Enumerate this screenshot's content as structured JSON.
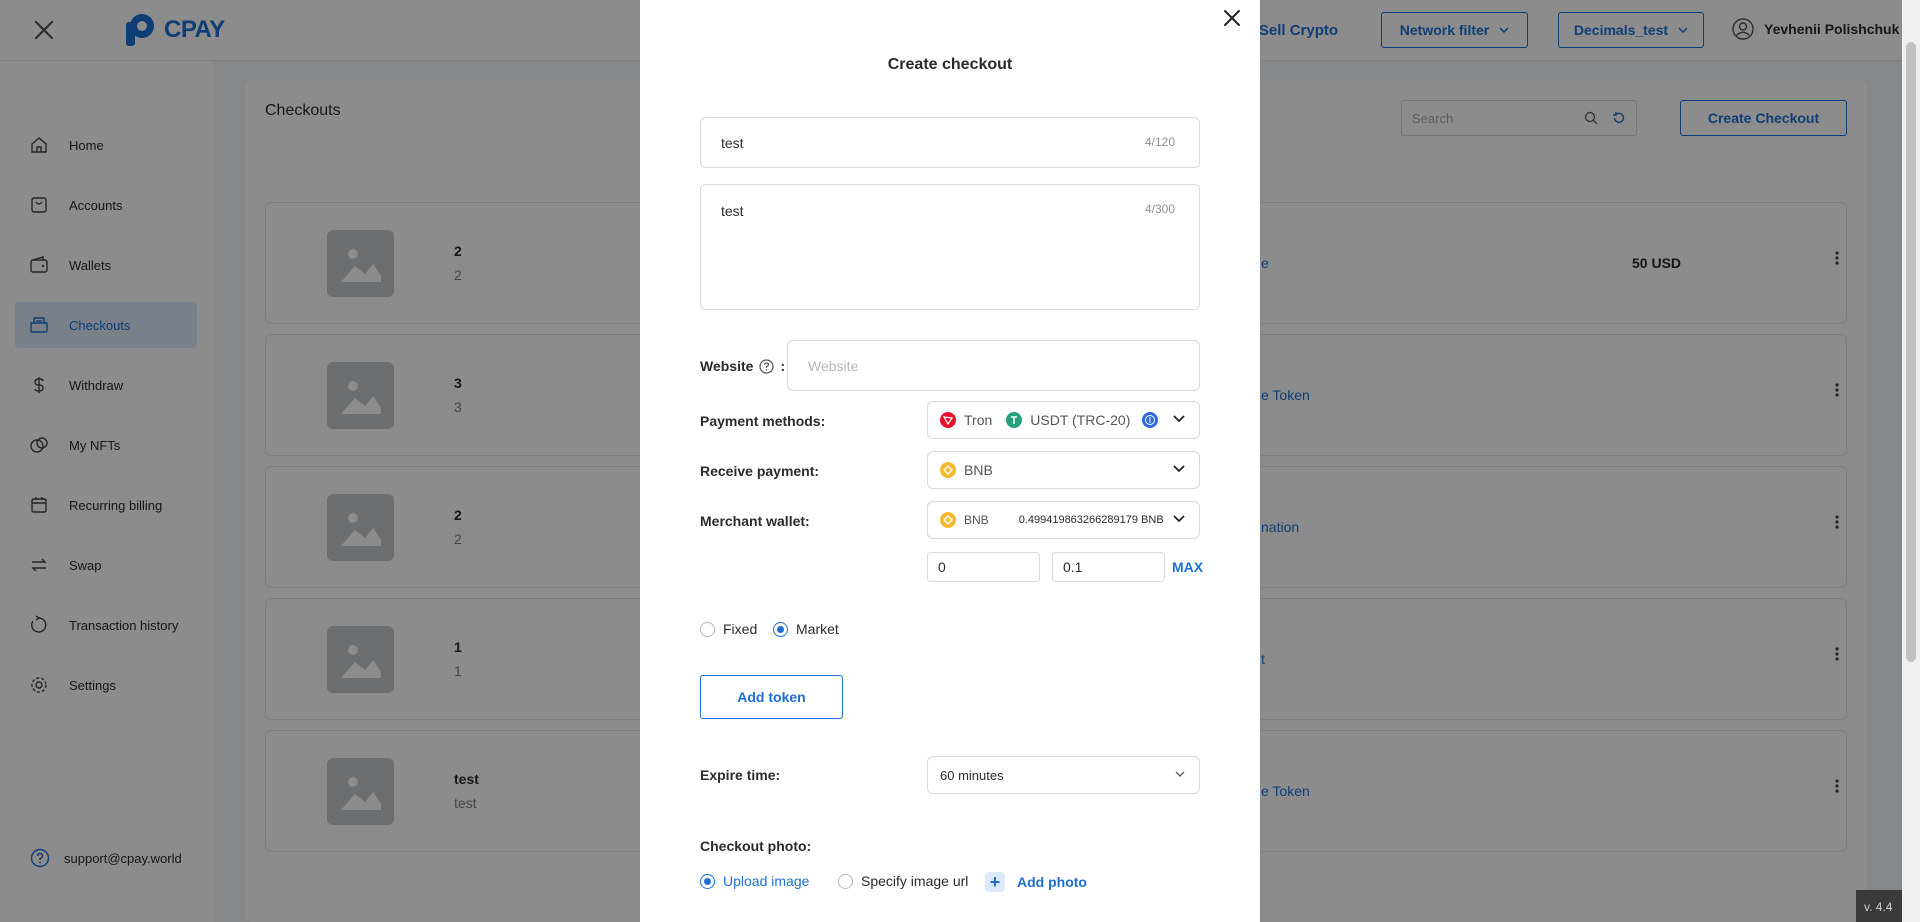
{
  "header": {
    "logo_text": "CPAY",
    "buy_sell_link": "ay/Sell Crypto",
    "network_filter": "Network filter",
    "decimals_filter": "Decimals_test",
    "user_name": "Yevhenii Polishchuk"
  },
  "sidebar": {
    "items": [
      {
        "label": "Home",
        "icon": "home-icon"
      },
      {
        "label": "Accounts",
        "icon": "accounts-icon"
      },
      {
        "label": "Wallets",
        "icon": "wallet-icon"
      },
      {
        "label": "Checkouts",
        "icon": "checkouts-icon",
        "active": true
      },
      {
        "label": "Withdraw",
        "icon": "dollar-icon"
      },
      {
        "label": "My NFTs",
        "icon": "nft-icon"
      },
      {
        "label": "Recurring billing",
        "icon": "calendar-icon"
      },
      {
        "label": "Swap",
        "icon": "swap-icon"
      },
      {
        "label": "Transaction history",
        "icon": "history-icon"
      },
      {
        "label": "Settings",
        "icon": "gear-icon"
      }
    ],
    "support_email": "support@cpay.world"
  },
  "checkouts": {
    "title": "Checkouts",
    "search_placeholder": "Search",
    "create_button": "Create Checkout",
    "rows": [
      {
        "title": "2",
        "subtitle": "2",
        "link": "e",
        "amount": "50 USD"
      },
      {
        "title": "3",
        "subtitle": "3",
        "link": "e Token",
        "amount": ""
      },
      {
        "title": "2",
        "subtitle": "2",
        "link": "nation",
        "amount": ""
      },
      {
        "title": "1",
        "subtitle": "1",
        "link": "t",
        "amount": ""
      },
      {
        "title": "test",
        "subtitle": "test",
        "link": "e Token",
        "amount": ""
      }
    ]
  },
  "modal": {
    "title": "Create checkout",
    "name_value": "test",
    "name_counter": "4/120",
    "description_value": "test",
    "description_counter": "4/300",
    "website_label": "Website",
    "website_colon": ":",
    "website_placeholder": "Website",
    "payment_methods_label": "Payment methods:",
    "payment_methods": {
      "network": "Tron",
      "token": "USDT (TRC-20)"
    },
    "receive_payment_label": "Receive payment:",
    "receive_payment_value": "BNB",
    "merchant_wallet_label": "Merchant wallet:",
    "merchant_wallet": {
      "currency": "BNB",
      "balance": "0.499419863266289179 BNB"
    },
    "min_amount": "0",
    "max_amount": "0.1",
    "max_label": "MAX",
    "rate_type": {
      "fixed": "Fixed",
      "market": "Market",
      "selected": "Market"
    },
    "add_token_button": "Add token",
    "expire_time_label": "Expire time",
    "expire_time_colon": ":",
    "expire_time_value": "60 minutes",
    "checkout_photo_label": "Checkout photo:",
    "photo_source": {
      "upload": "Upload image",
      "url": "Specify image url",
      "selected": "Upload image"
    },
    "add_photo": "Add photo"
  },
  "version": "v. 4.4",
  "colors": {
    "accent": "#1d6fd6",
    "tron": "#e8112d",
    "tether": "#26a17b",
    "bnb": "#f3ba2f"
  }
}
